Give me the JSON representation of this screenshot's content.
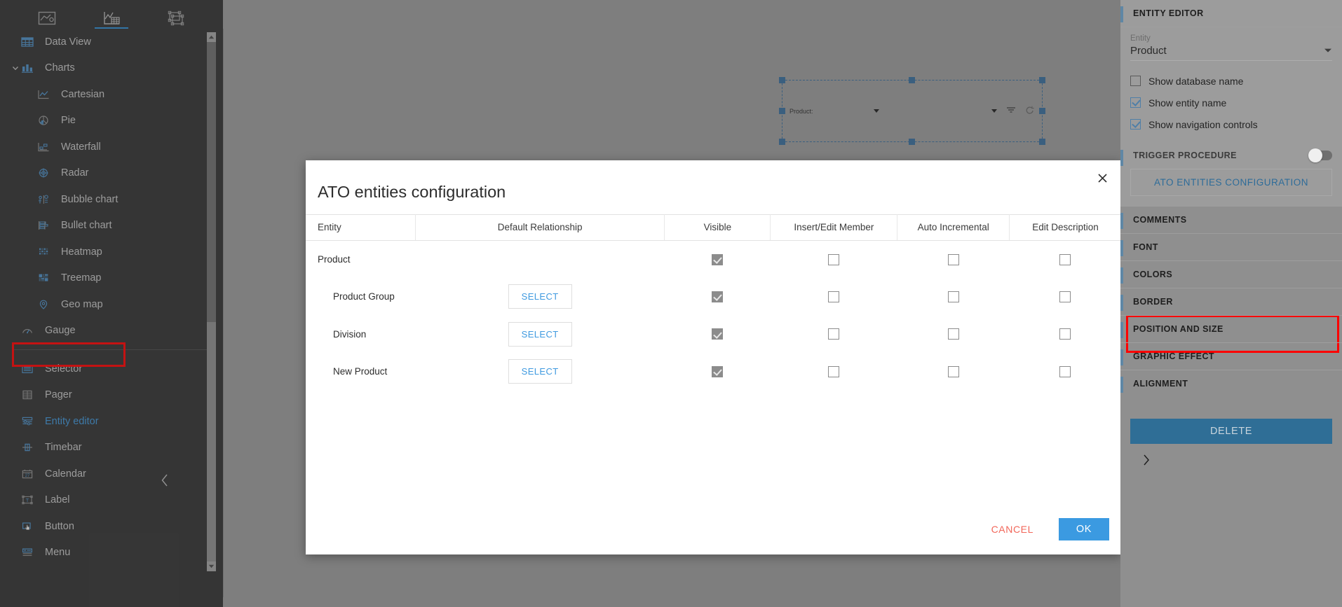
{
  "toolbar": {
    "tabs": [
      {
        "name": "chart-designer-icon",
        "label": "Chart designer",
        "active": false
      },
      {
        "name": "data-chart-icon",
        "label": "Data chart",
        "active": true
      },
      {
        "name": "layout-objects-icon",
        "label": "Layout objects",
        "active": false
      }
    ]
  },
  "sidebar": {
    "items": [
      {
        "label": "Data View",
        "icon": "grid-icon",
        "level": 0,
        "chevron": false,
        "selected": false
      },
      {
        "label": "Charts",
        "icon": "bar-chart-icon",
        "level": 0,
        "chevron": true,
        "selected": false
      },
      {
        "label": "Cartesian",
        "icon": "line-chart-icon",
        "level": 1,
        "chevron": false,
        "selected": false
      },
      {
        "label": "Pie",
        "icon": "pie-chart-icon",
        "level": 1,
        "chevron": false,
        "selected": false
      },
      {
        "label": "Waterfall",
        "icon": "waterfall-icon",
        "level": 1,
        "chevron": false,
        "selected": false
      },
      {
        "label": "Radar",
        "icon": "radar-icon",
        "level": 1,
        "chevron": false,
        "selected": false
      },
      {
        "label": "Bubble chart",
        "icon": "bubble-chart-icon",
        "level": 1,
        "chevron": false,
        "selected": false
      },
      {
        "label": "Bullet chart",
        "icon": "bullet-chart-icon",
        "level": 1,
        "chevron": false,
        "selected": false
      },
      {
        "label": "Heatmap",
        "icon": "heatmap-icon",
        "level": 1,
        "chevron": false,
        "selected": false
      },
      {
        "label": "Treemap",
        "icon": "treemap-icon",
        "level": 1,
        "chevron": false,
        "selected": false
      },
      {
        "label": "Geo map",
        "icon": "geo-map-icon",
        "level": 1,
        "chevron": false,
        "selected": false
      },
      {
        "label": "Gauge",
        "icon": "gauge-icon",
        "level": 0,
        "chevron": false,
        "selected": false
      },
      {
        "separator": true
      },
      {
        "label": "Selector",
        "icon": "selector-icon",
        "level": 0,
        "chevron": false,
        "selected": false
      },
      {
        "label": "Pager",
        "icon": "pager-icon",
        "level": 0,
        "chevron": false,
        "selected": false
      },
      {
        "label": "Entity editor",
        "icon": "entity-editor-icon",
        "level": 0,
        "chevron": false,
        "selected": true
      },
      {
        "label": "Timebar",
        "icon": "timebar-icon",
        "level": 0,
        "chevron": false,
        "selected": false
      },
      {
        "label": "Calendar",
        "icon": "calendar-icon",
        "level": 0,
        "chevron": false,
        "selected": false
      },
      {
        "label": "Label",
        "icon": "label-icon",
        "level": 0,
        "chevron": false,
        "selected": false
      },
      {
        "label": "Button",
        "icon": "button-icon",
        "level": 0,
        "chevron": false,
        "selected": false
      },
      {
        "label": "Menu",
        "icon": "menu-icon",
        "level": 0,
        "chevron": false,
        "selected": false
      }
    ],
    "collapse_icon": "chevron-left-icon"
  },
  "canvas": {
    "widget": {
      "entity_label": "Product:",
      "icons": [
        "chevron-down-icon",
        "chevron-down-icon",
        "filter-icon",
        "refresh-icon"
      ]
    }
  },
  "dialog": {
    "title": "ATO entities configuration",
    "close_icon": "close-icon",
    "columns": [
      "Entity",
      "Default Relationship",
      "Visible",
      "Insert/Edit Member",
      "Auto Incremental",
      "Edit Description"
    ],
    "rows": [
      {
        "entity": "Product",
        "indent": false,
        "relationship_button": null,
        "visible": true,
        "insert_edit_member": false,
        "auto_incremental": false,
        "edit_description": false
      },
      {
        "entity": "Product Group",
        "indent": true,
        "relationship_button": "SELECT",
        "visible": true,
        "insert_edit_member": false,
        "auto_incremental": false,
        "edit_description": false
      },
      {
        "entity": "Division",
        "indent": true,
        "relationship_button": "SELECT",
        "visible": true,
        "insert_edit_member": false,
        "auto_incremental": false,
        "edit_description": false
      },
      {
        "entity": "New Product",
        "indent": true,
        "relationship_button": "SELECT",
        "visible": true,
        "insert_edit_member": false,
        "auto_incremental": false,
        "edit_description": false
      }
    ],
    "cancel_label": "CANCEL",
    "ok_label": "OK"
  },
  "right_panel": {
    "title": "ENTITY EDITOR",
    "entity_field_label": "Entity",
    "entity_value": "Product",
    "entity_dropdown_icon": "chevron-down-icon",
    "checkboxes": [
      {
        "label": "Show database name",
        "checked": false
      },
      {
        "label": "Show entity name",
        "checked": true
      },
      {
        "label": "Show navigation controls",
        "checked": true
      }
    ],
    "trigger_procedure_label": "TRIGGER PROCEDURE",
    "trigger_procedure_on": false,
    "ato_button_label": "ATO ENTITIES CONFIGURATION",
    "sections": [
      "COMMENTS",
      "FONT",
      "COLORS",
      "BORDER",
      "POSITION AND SIZE",
      "GRAPHIC EFFECT",
      "ALIGNMENT"
    ],
    "delete_label": "DELETE",
    "expand_icon": "chevron-right-icon"
  },
  "colors": {
    "accent_blue": "#3b9ae1",
    "sidebar_bg": "#333333",
    "canvas_bg": "#9b9b9b",
    "panel_bg": "#8f8f8f",
    "highlight_red": "#ff0000",
    "cancel_red": "#f2675a",
    "delete_blue": "#2f6e96",
    "section_accent": "#5f87a5"
  }
}
